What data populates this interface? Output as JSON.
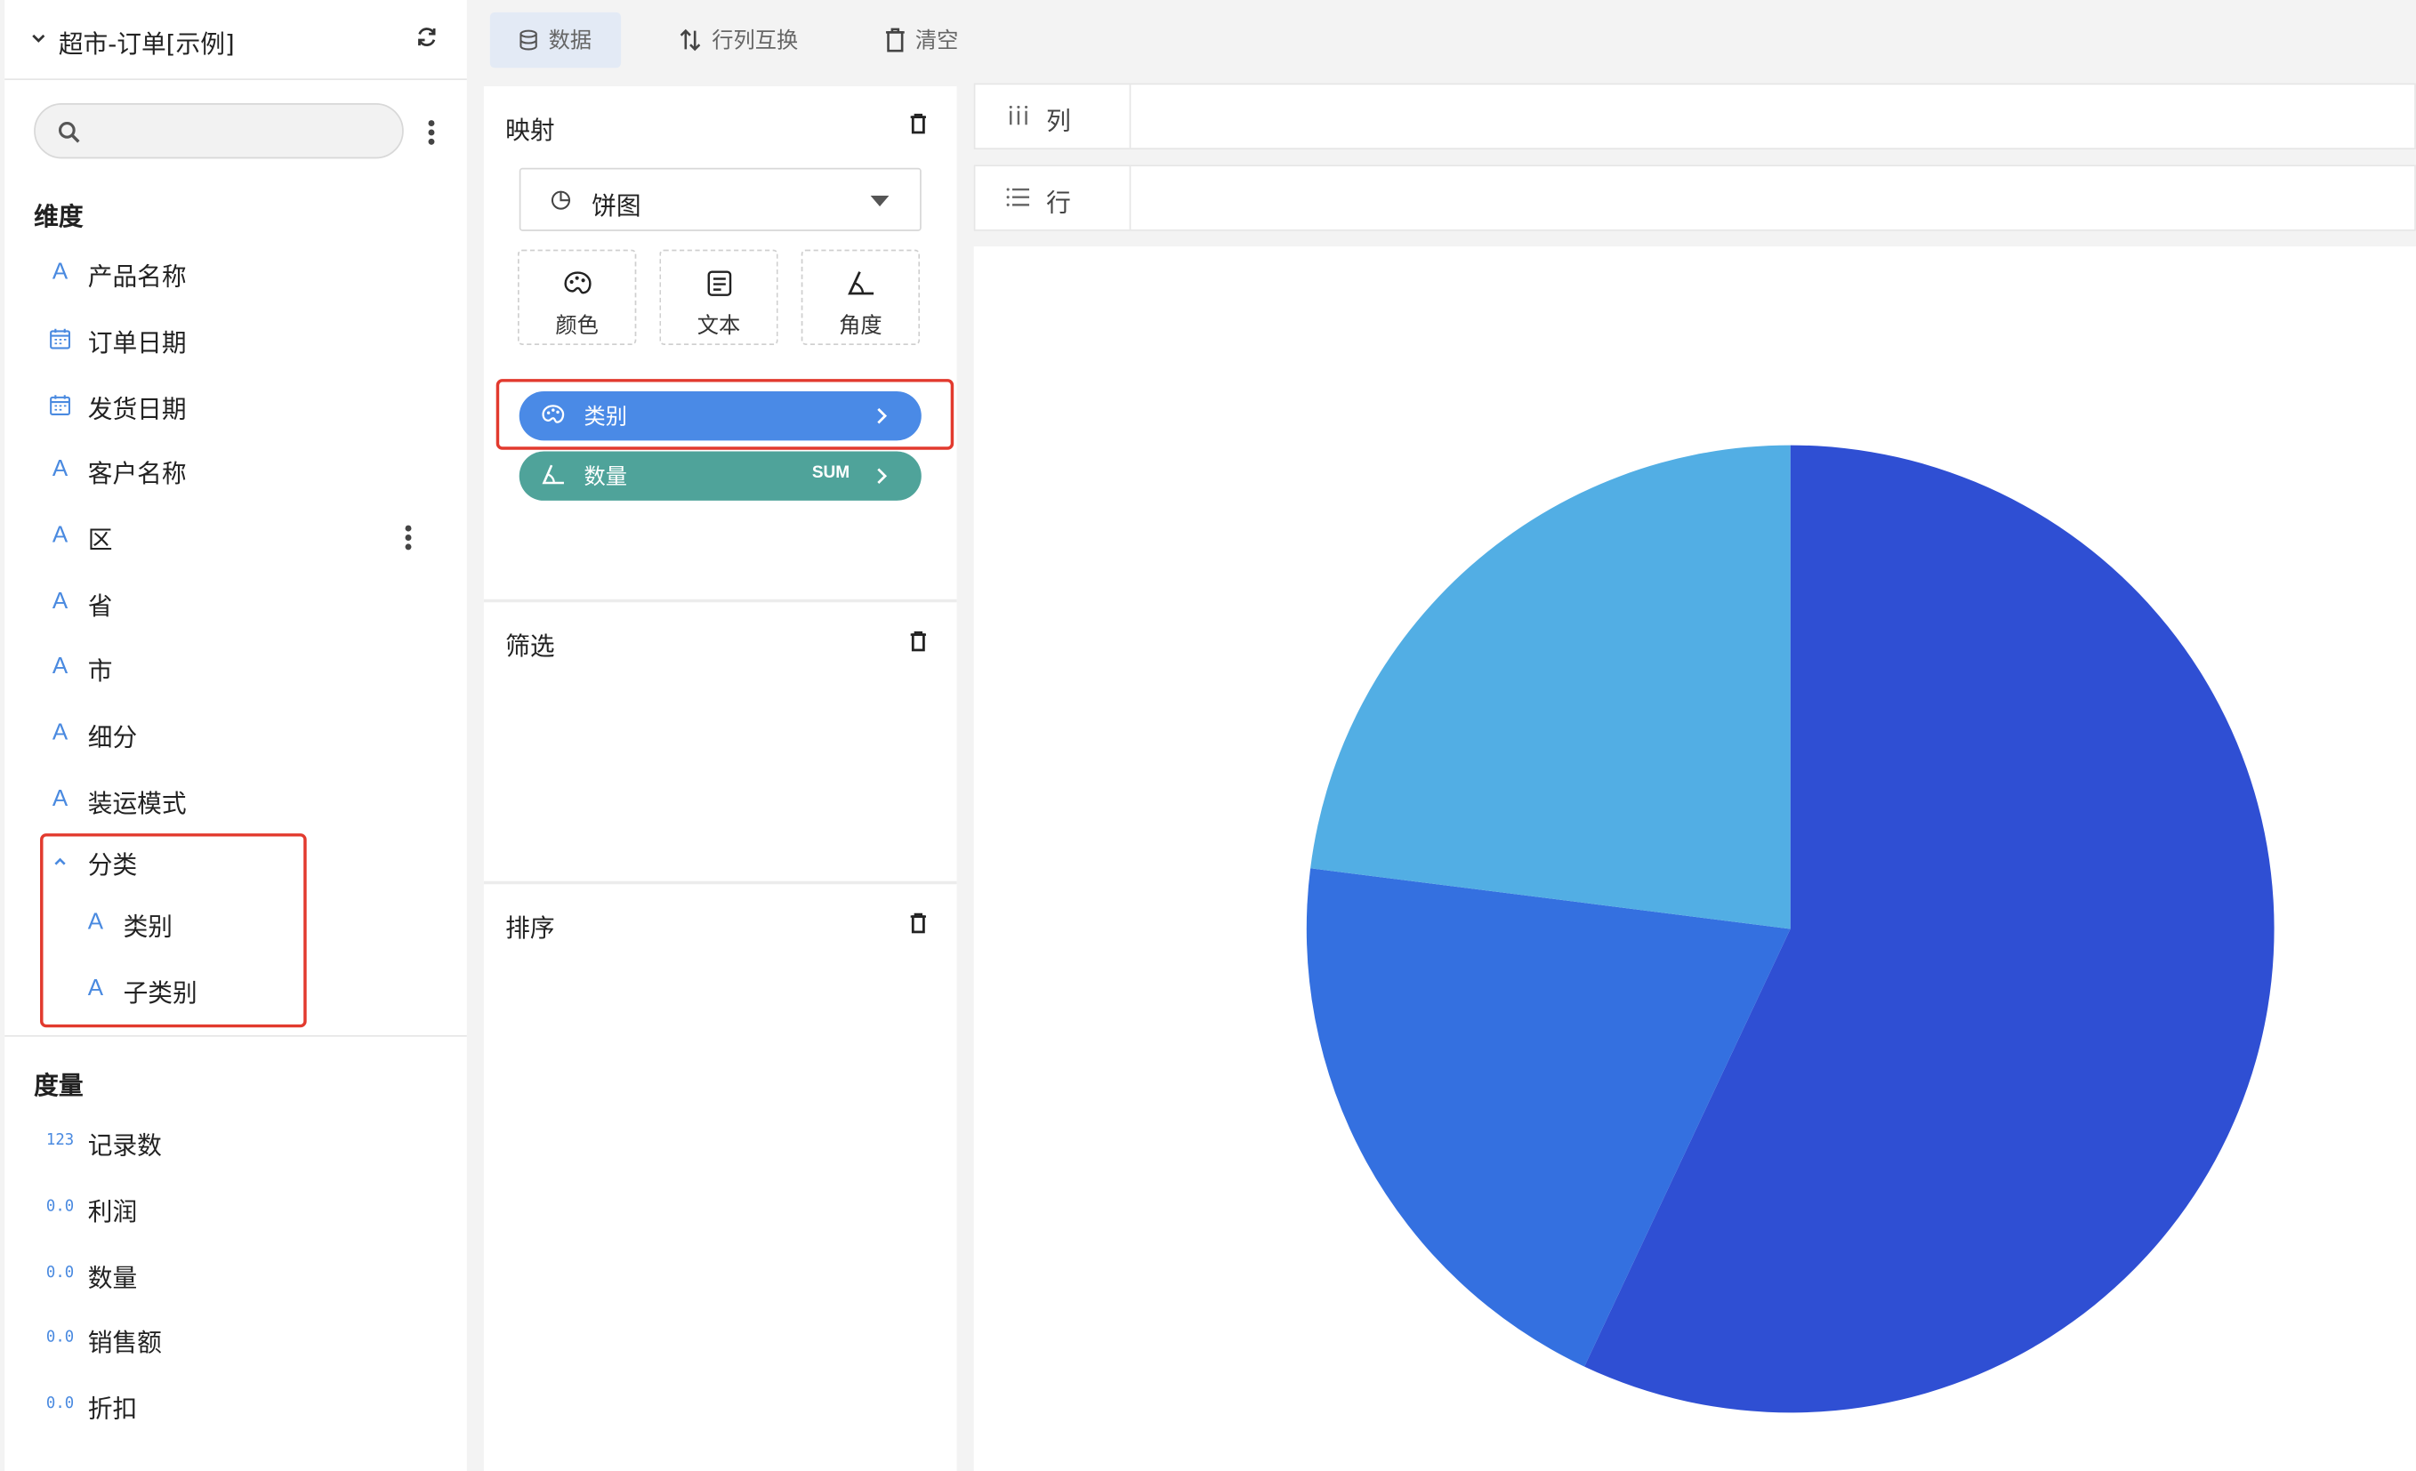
{
  "datasource": {
    "title": "超市-订单[示例]"
  },
  "search": {
    "placeholder": ""
  },
  "dimensions": {
    "title": "维度",
    "items": [
      {
        "label": "产品名称",
        "type": "A"
      },
      {
        "label": "订单日期",
        "type": "date"
      },
      {
        "label": "发货日期",
        "type": "date"
      },
      {
        "label": "客户名称",
        "type": "A"
      },
      {
        "label": "区",
        "type": "A"
      },
      {
        "label": "省",
        "type": "A"
      },
      {
        "label": "市",
        "type": "A"
      },
      {
        "label": "细分",
        "type": "A"
      },
      {
        "label": "装运模式",
        "type": "A"
      }
    ],
    "group": {
      "label": "分类",
      "children": [
        {
          "label": "类别",
          "type": "A"
        },
        {
          "label": "子类别",
          "type": "A"
        }
      ]
    }
  },
  "measures": {
    "title": "度量",
    "items": [
      {
        "label": "记录数",
        "type": "123"
      },
      {
        "label": "利润",
        "type": "0.0"
      },
      {
        "label": "数量",
        "type": "0.0"
      },
      {
        "label": "销售额",
        "type": "0.0"
      },
      {
        "label": "折扣",
        "type": "0.0"
      }
    ]
  },
  "toolbar": {
    "data_label": "数据",
    "swap_label": "行列互换",
    "clear_label": "清空"
  },
  "mapping": {
    "title": "映射",
    "chart_type": "饼图",
    "encodings": [
      "颜色",
      "文本",
      "角度"
    ],
    "pills": [
      {
        "label": "类别",
        "color": "#4a8ae6"
      },
      {
        "label": "数量",
        "agg": "SUM",
        "color": "#4fa39a"
      }
    ]
  },
  "filter": {
    "title": "筛选"
  },
  "sort": {
    "title": "排序"
  },
  "shelves": {
    "columns_label": "列",
    "rows_label": "行"
  },
  "colors": {
    "highlight": "#e23a2e",
    "accent": "#4a8ae0"
  },
  "chart_data": {
    "type": "pie",
    "categories": [
      "",
      "",
      ""
    ],
    "values": [
      57,
      20,
      23
    ],
    "colors": [
      "#2f4fd3",
      "#3470e0",
      "#52aee4"
    ]
  }
}
